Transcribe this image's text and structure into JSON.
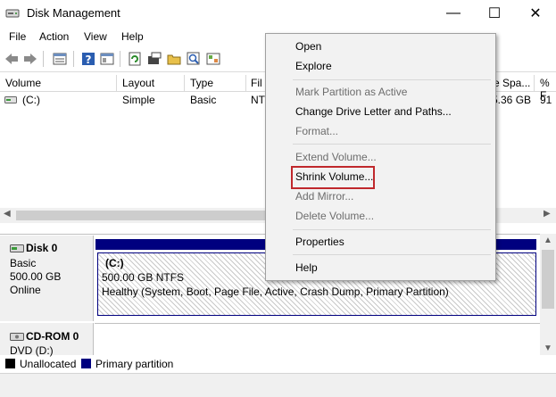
{
  "window": {
    "title": "Disk Management",
    "title_icon": "disk-management-icon",
    "controls": {
      "minimize": "—",
      "maximize": "☐",
      "close": "✕"
    }
  },
  "menubar": {
    "items": [
      {
        "label": "File"
      },
      {
        "label": "Action"
      },
      {
        "label": "View"
      },
      {
        "label": "Help"
      }
    ]
  },
  "toolbar": {
    "icons": [
      "back-arrow-icon",
      "forward-arrow-icon",
      "list-view-icon",
      "help-icon",
      "properties-view-icon",
      "refresh-icon",
      "rescan-icon",
      "open-folder-icon",
      "search-icon",
      "settings-icon"
    ]
  },
  "volume_list": {
    "columns": [
      "Volume",
      "Layout",
      "Type",
      "Fil",
      "e Spa...",
      "% F"
    ],
    "rows": [
      {
        "volume": "(C:)",
        "layout": "Simple",
        "type": "Basic",
        "fs": "NT",
        "free": "5.36 GB",
        "pct": "91"
      }
    ]
  },
  "disks": [
    {
      "name": "Disk 0",
      "kind": "Basic",
      "size": "500.00 GB",
      "status": "Online",
      "partition": {
        "label": "(C:)",
        "size_fs": "500.00 GB NTFS",
        "health": "Healthy (System, Boot, Page File, Active, Crash Dump, Primary Partition)"
      }
    },
    {
      "name": "CD-ROM 0",
      "kind": "DVD (D:)"
    }
  ],
  "legend": [
    {
      "label": "Unallocated",
      "color": "#000000"
    },
    {
      "label": "Primary partition",
      "color": "#00007f"
    }
  ],
  "context_menu": {
    "items": [
      {
        "label": "Open",
        "enabled": true
      },
      {
        "label": "Explore",
        "enabled": true
      },
      {
        "label": "Mark Partition as Active",
        "enabled": false
      },
      {
        "label": "Change Drive Letter and Paths...",
        "enabled": true
      },
      {
        "label": "Format...",
        "enabled": false
      },
      {
        "label": "Extend Volume...",
        "enabled": false
      },
      {
        "label": "Shrink Volume...",
        "enabled": true,
        "highlighted": true
      },
      {
        "label": "Add Mirror...",
        "enabled": false
      },
      {
        "label": "Delete Volume...",
        "enabled": false
      },
      {
        "label": "Properties",
        "enabled": true
      },
      {
        "label": "Help",
        "enabled": true
      }
    ],
    "highlight_color": "#c0282c"
  }
}
